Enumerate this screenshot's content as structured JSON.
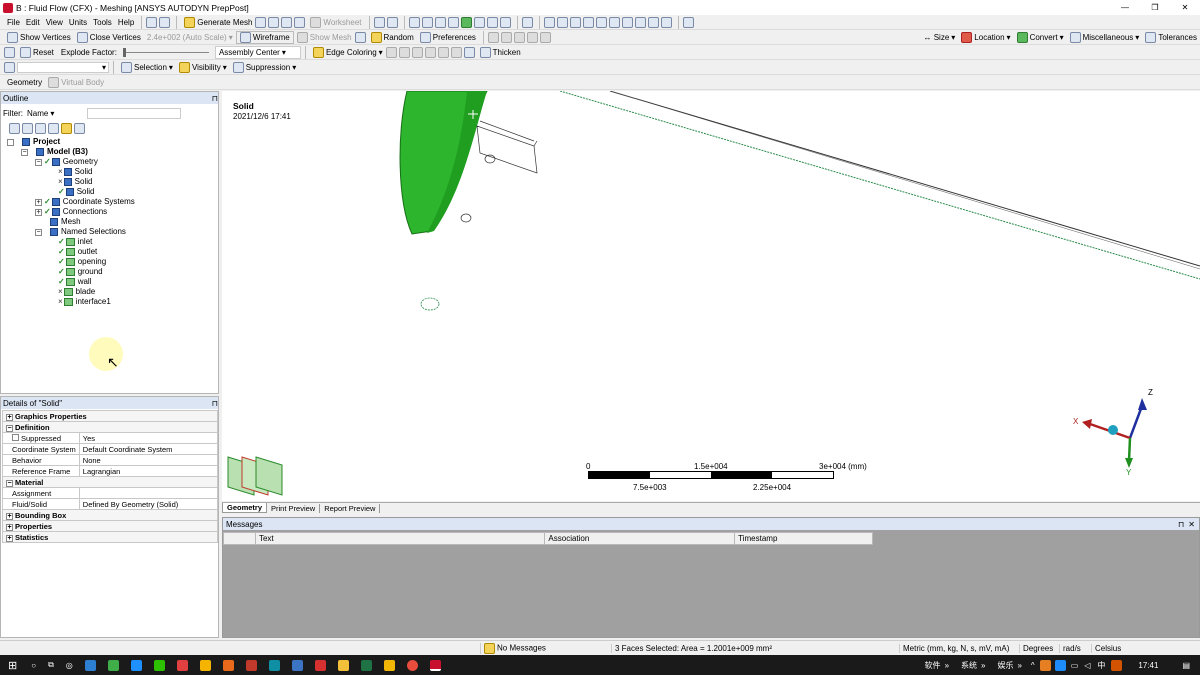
{
  "window": {
    "title": "B : Fluid Flow (CFX) - Meshing [ANSYS AUTODYN PrepPost]",
    "app_icon": "ansys-icon"
  },
  "menu": [
    "File",
    "Edit",
    "View",
    "Units",
    "Tools",
    "Help"
  ],
  "toolbar1": {
    "generate_mesh": "Generate Mesh",
    "worksheet": "Worksheet"
  },
  "toolbar2": {
    "show_vertices": "Show Vertices",
    "close_vertices": "Close Vertices",
    "auto_scale": "2.4e+002 (Auto Scale)",
    "wireframe": "Wireframe",
    "show_mesh": "Show Mesh",
    "random": "Random",
    "preferences": "Preferences",
    "size": "Size",
    "location": "Location",
    "convert": "Convert",
    "miscellaneous": "Miscellaneous",
    "tolerances": "Tolerances"
  },
  "toolbar3": {
    "reset": "Reset",
    "explode_factor": "Explode Factor:",
    "assembly_center": "Assembly Center",
    "edge_coloring": "Edge Coloring",
    "thicken": "Thicken"
  },
  "toolbar4": {
    "selection": "Selection",
    "visibility": "Visibility",
    "suppression": "Suppression"
  },
  "toolbar5": {
    "geometry": "Geometry",
    "virtual_body": "Virtual Body"
  },
  "outline": {
    "title": "Outline",
    "filter_label": "Filter:",
    "filter_value": "Name",
    "items": [
      {
        "label": "Project",
        "bold": true,
        "level": 0,
        "mark": ""
      },
      {
        "label": "Model (B3)",
        "bold": true,
        "level": 1,
        "mark": ""
      },
      {
        "label": "Geometry",
        "level": 2,
        "mark": "tick"
      },
      {
        "label": "Solid",
        "level": 3,
        "mark": "x"
      },
      {
        "label": "Solid",
        "level": 3,
        "mark": "x"
      },
      {
        "label": "Solid",
        "level": 3,
        "mark": "tick"
      },
      {
        "label": "Coordinate Systems",
        "level": 2,
        "mark": "tick"
      },
      {
        "label": "Connections",
        "level": 2,
        "mark": "tick"
      },
      {
        "label": "Mesh",
        "level": 2,
        "mark": ""
      },
      {
        "label": "Named Selections",
        "level": 2,
        "mark": ""
      },
      {
        "label": "inlet",
        "level": 3,
        "mark": "tick"
      },
      {
        "label": "outlet",
        "level": 3,
        "mark": "tick"
      },
      {
        "label": "opening",
        "level": 3,
        "mark": "tick"
      },
      {
        "label": "ground",
        "level": 3,
        "mark": "tick"
      },
      {
        "label": "wall",
        "level": 3,
        "mark": "tick"
      },
      {
        "label": "blade",
        "level": 3,
        "mark": "x"
      },
      {
        "label": "interface1",
        "level": 3,
        "mark": "x"
      }
    ]
  },
  "details": {
    "title": "Details of \"Solid\"",
    "rows": [
      {
        "k": "Graphics Properties",
        "v": "",
        "group": true,
        "sign": "+"
      },
      {
        "k": "Definition",
        "v": "",
        "group": true,
        "sign": "-"
      },
      {
        "k": "Suppressed",
        "v": "Yes",
        "check": true
      },
      {
        "k": "Coordinate System",
        "v": "Default Coordinate System"
      },
      {
        "k": "Behavior",
        "v": "None"
      },
      {
        "k": "Reference Frame",
        "v": "Lagrangian"
      },
      {
        "k": "Material",
        "v": "",
        "group": true,
        "sign": "-"
      },
      {
        "k": "Assignment",
        "v": ""
      },
      {
        "k": "Fluid/Solid",
        "v": "Defined By Geometry (Solid)"
      },
      {
        "k": "Bounding Box",
        "v": "",
        "group": true,
        "sign": "+"
      },
      {
        "k": "Properties",
        "v": "",
        "group": true,
        "sign": "+"
      },
      {
        "k": "Statistics",
        "v": "",
        "group": true,
        "sign": "+"
      }
    ]
  },
  "viewport": {
    "label": "Solid",
    "date": "2021/12/6 17:41",
    "scale": {
      "s0": "0",
      "s1": "1.5e+004",
      "s2": "3e+004 (mm)",
      "s3": "7.5e+003",
      "s4": "2.25e+004"
    },
    "axes": {
      "z": "Z",
      "x": "X",
      "y": "Y"
    }
  },
  "view_tabs": [
    "Geometry",
    "Print Preview",
    "Report Preview"
  ],
  "messages": {
    "title": "Messages",
    "columns": [
      "Text",
      "Association",
      "Timestamp"
    ]
  },
  "status": {
    "messages": "No Messages",
    "selection": "3 Faces Selected: Area = 1.2001e+009 mm²",
    "units": "Metric (mm, kg, N, s, mV, mA)",
    "degrees": "Degrees",
    "rad": "rad/s",
    "celsius": "Celsius"
  },
  "taskbar": {
    "tray1": "软件",
    "tray2": "系统",
    "tray3": "娱乐",
    "lang": "中",
    "time": "17:41"
  }
}
